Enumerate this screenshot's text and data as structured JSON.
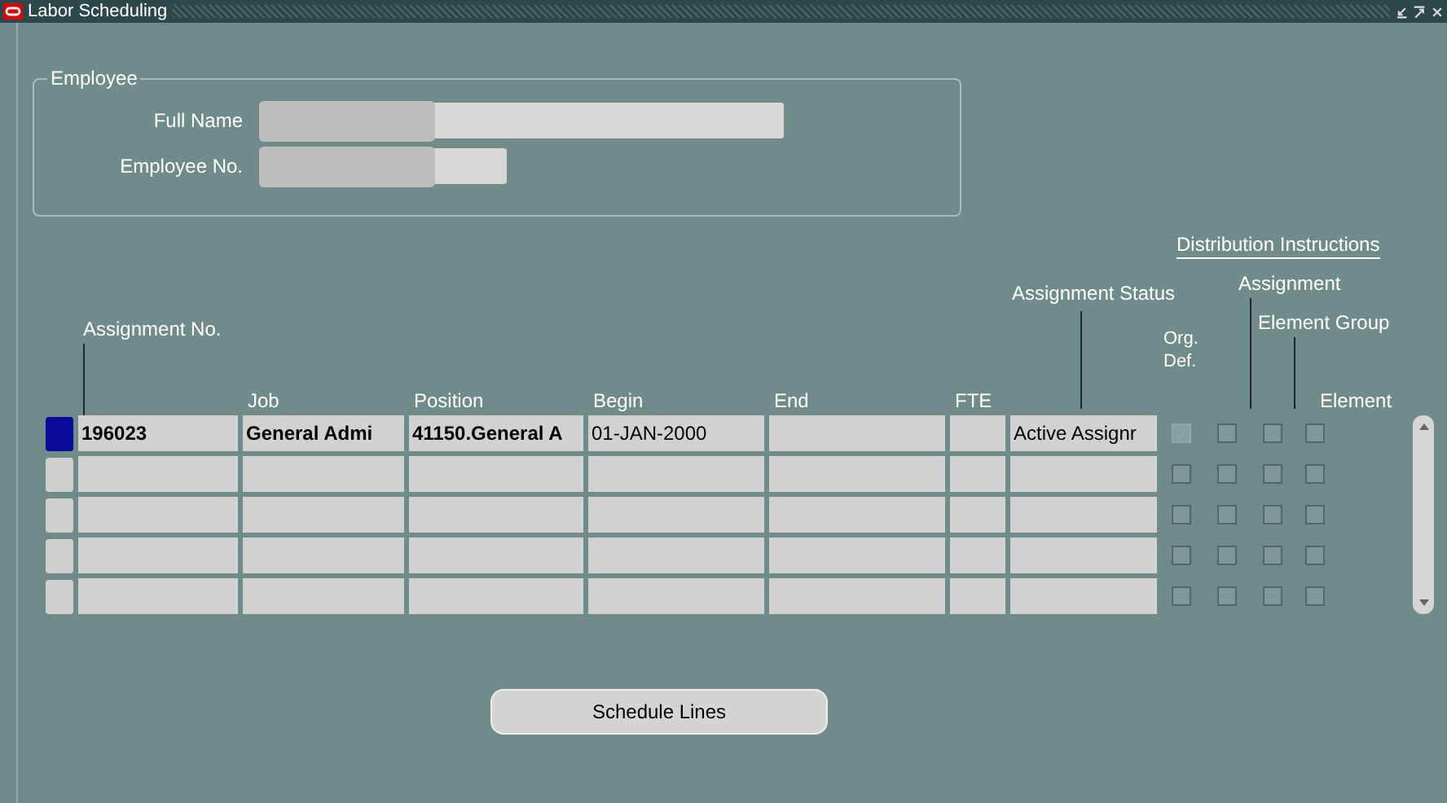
{
  "window": {
    "title": "Labor Scheduling"
  },
  "employee": {
    "legend": "Employee",
    "fields": [
      {
        "label": "Full Name",
        "redacted": true
      },
      {
        "label": "Employee No.",
        "redacted": true
      }
    ]
  },
  "table": {
    "columns": [
      "Assignment No.",
      "Job",
      "Position",
      "Begin",
      "End",
      "FTE",
      "Assignment Status"
    ],
    "checkbox_header": "Distribution Instructions",
    "checkbox_columns": [
      "Org. Def.",
      "Assignment",
      "Element Group",
      "Element"
    ],
    "rows": [
      {
        "selected": true,
        "cells": [
          "196023",
          "General Admi",
          "41150.General A",
          "01-JAN-2000",
          "",
          "",
          "Active Assignr"
        ],
        "checks": [
          {
            "checked": true,
            "disabled": true
          },
          {
            "checked": false,
            "disabled": false
          },
          {
            "checked": false,
            "disabled": false
          },
          {
            "checked": false,
            "disabled": false
          }
        ]
      },
      {
        "selected": false,
        "cells": [
          "",
          "",
          "",
          "",
          "",
          "",
          ""
        ],
        "checks": [
          {
            "checked": false,
            "disabled": false
          },
          {
            "checked": false,
            "disabled": false
          },
          {
            "checked": false,
            "disabled": false
          },
          {
            "checked": false,
            "disabled": false
          }
        ]
      },
      {
        "selected": false,
        "cells": [
          "",
          "",
          "",
          "",
          "",
          "",
          ""
        ],
        "checks": [
          {
            "checked": false,
            "disabled": false
          },
          {
            "checked": false,
            "disabled": false
          },
          {
            "checked": false,
            "disabled": false
          },
          {
            "checked": false,
            "disabled": false
          }
        ]
      },
      {
        "selected": false,
        "cells": [
          "",
          "",
          "",
          "",
          "",
          "",
          ""
        ],
        "checks": [
          {
            "checked": false,
            "disabled": false
          },
          {
            "checked": false,
            "disabled": false
          },
          {
            "checked": false,
            "disabled": false
          },
          {
            "checked": false,
            "disabled": false
          }
        ]
      },
      {
        "selected": false,
        "cells": [
          "",
          "",
          "",
          "",
          "",
          "",
          ""
        ],
        "checks": [
          {
            "checked": false,
            "disabled": false
          },
          {
            "checked": false,
            "disabled": false
          },
          {
            "checked": false,
            "disabled": false
          },
          {
            "checked": false,
            "disabled": false
          }
        ]
      }
    ]
  },
  "buttons": [
    "Schedule Lines"
  ]
}
